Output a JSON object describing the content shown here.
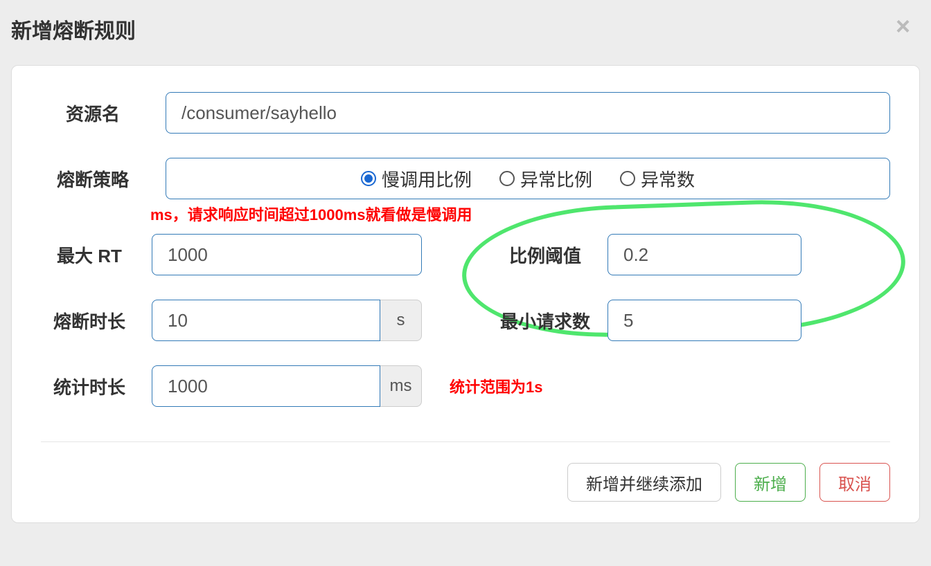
{
  "modal": {
    "title": "新增熔断规则",
    "close_symbol": "×"
  },
  "fields": {
    "resource_name": {
      "label": "资源名",
      "value": "/consumer/sayhello"
    },
    "strategy": {
      "label": "熔断策略",
      "options": {
        "slow": "慢调用比例",
        "error_ratio": "异常比例",
        "error_count": "异常数"
      },
      "selected": "slow"
    },
    "max_rt": {
      "label": "最大 RT",
      "value": "1000"
    },
    "ratio_threshold": {
      "label": "比例阈值",
      "value": "0.2"
    },
    "break_duration": {
      "label": "熔断时长",
      "value": "10",
      "unit": "s"
    },
    "min_requests": {
      "label": "最小请求数",
      "value": "5"
    },
    "stat_window": {
      "label": "统计时长",
      "value": "1000",
      "unit": "ms"
    }
  },
  "annotations": {
    "rt_note": "ms，请求响应时间超过1000ms就看做是慢调用",
    "stat_note": "统计范围为1s"
  },
  "buttons": {
    "add_continue": "新增并继续添加",
    "add": "新增",
    "cancel": "取消"
  }
}
